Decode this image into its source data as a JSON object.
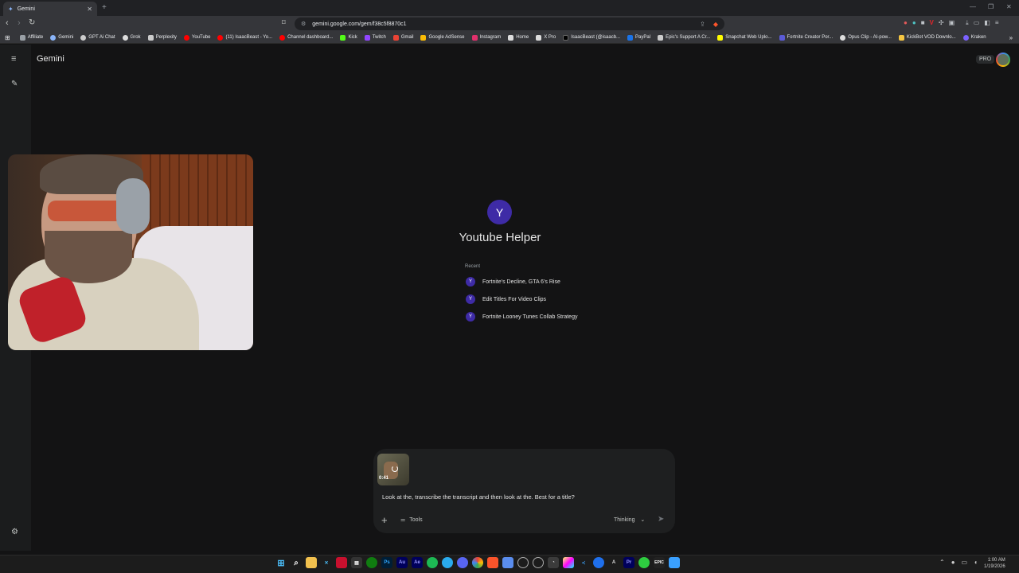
{
  "browser": {
    "tab_title": "Gemini",
    "url": "gemini.google.com/gem/f38c5f8870c1",
    "bookmarks": [
      "Affiliate",
      "Gemini",
      "GPT Ai Chat",
      "Grok",
      "Perplexity",
      "YouTube",
      "(11) IsaacBeast - Yo...",
      "Channel dashboard...",
      "Kick",
      "Twitch",
      "Gmail",
      "Google AdSense",
      "Instagram",
      "Home",
      "X Pro",
      "IsaacBeast (@isaacb...",
      "PayPal",
      "Epic's Support A Cr...",
      "Snapchat Web Uplo...",
      "Fortnite Creator Por...",
      "Opus Clip - AI-pow...",
      "KickBot VOD Downlo...",
      "Kraken"
    ]
  },
  "app": {
    "name": "Gemini",
    "pro_badge": "PRO"
  },
  "gem": {
    "initial": "Y",
    "title": "Youtube Helper",
    "recent_label": "Recent",
    "recent_items": [
      {
        "icon": "Y",
        "label": "Fortnite's Decline, GTA 6's Rise"
      },
      {
        "icon": "Y",
        "label": "Edit Titles For Video Clips"
      },
      {
        "icon": "Y",
        "label": "Fortnite Looney Tunes Collab Strategy"
      }
    ]
  },
  "composer": {
    "attachment_duration": "0:41",
    "prompt_text": "Look at the, transcribe the transcript and then look at the. Best for a title?",
    "tools_label": "Tools",
    "mode_label": "Thinking"
  },
  "taskbar": {
    "time": "1:00 AM",
    "date": "1/19/2026"
  }
}
